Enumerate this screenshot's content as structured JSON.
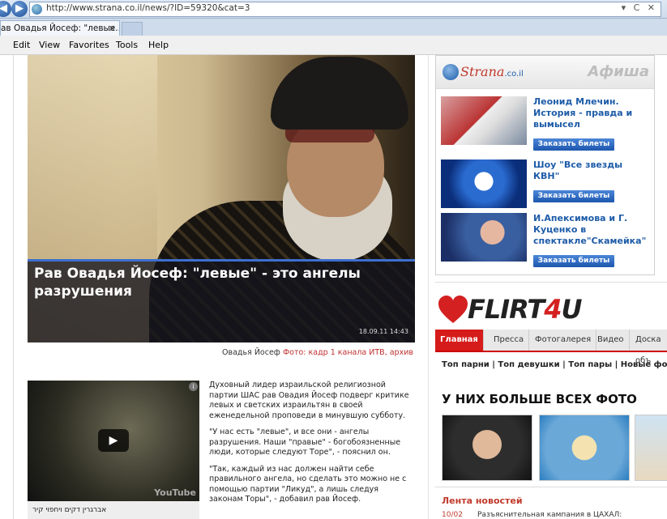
{
  "browser": {
    "url": "http://www.strana.co.il/news/?ID=59320&cat=3",
    "url_controls": "▾ C ✕",
    "tab_title": "ав Овадья Йосеф: \"левые...",
    "tab_close": "✕",
    "menu": [
      "Edit",
      "View",
      "Favorites",
      "Tools",
      "Help"
    ]
  },
  "hero": {
    "title": "Рав Овадья Йосеф: \"левые\" - это ангелы разрушения",
    "date": "18.09.11 14:43",
    "credit_name": "Овадья Йосеф",
    "credit_source": "Фото: кадр 1 канала ИТВ, архив"
  },
  "video": {
    "title": "אברגרין דקים ויחפוי קיר",
    "play": "▶",
    "info": "i",
    "logo": "YouTube"
  },
  "article": {
    "paragraphs": [
      "Духовный лидер израильской религиозной партии ШАС рав Овадия Йосеф подверг критике левых и светских израильтян в своей еженедельной проповеди в минувшую субботу.",
      "\"У нас есть \"левые\", и все они - ангелы разрушения. Наши \"правые\" - богобоязненные люди, которые следуют Торе\", - пояснил он.",
      "\"Так, каждый из нас должен найти себе правильного ангела, но сделать это можно не с помощью партии \"Ликуд\", а лишь следуя законам Торы\", - добавил рав Йосеф."
    ]
  },
  "afisha": {
    "logo_text": "Strana",
    "logo_suffix": ".co.il",
    "heading": "Афиша",
    "items": [
      {
        "title": "Леонид Млечин. История - правда и вымысел",
        "button": "Заказать билеты"
      },
      {
        "title": "Шоу \"Все звезды КВН\"",
        "button": "Заказать билеты"
      },
      {
        "title": "И.Апексимова и Г. Куценко в спектакле\"Скамейка\"",
        "button": "Заказать билеты"
      }
    ]
  },
  "flirt": {
    "logo_a": "FLIRT",
    "logo_b": "4",
    "logo_c": "U",
    "tabs": [
      "Главная",
      "Пресса",
      "Фотогалерея",
      "Видео",
      "Доска объ"
    ],
    "sublinks": "Топ парни | Топ девушки | Топ пары | Новые фото",
    "heading": "У НИХ БОЛЬШЕ ВСЕХ ФОТО"
  },
  "news": {
    "heading": "Лента новостей",
    "date": "10/02",
    "item": "Разъяснительная кампания в ЦАХАЛ:"
  }
}
